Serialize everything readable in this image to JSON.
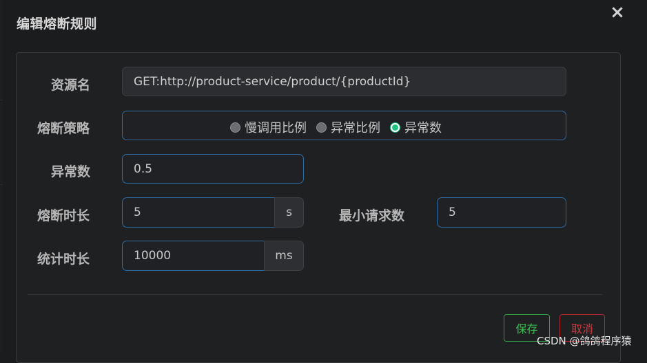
{
  "dialog": {
    "title": "编辑熔断规则",
    "close_symbol": "×"
  },
  "form": {
    "resource_label": "资源名",
    "resource_value": "GET:http://product-service/product/{productId}",
    "strategy_label": "熔断策略",
    "strategy_options": [
      {
        "label": "慢调用比例",
        "checked": false
      },
      {
        "label": "异常比例",
        "checked": false
      },
      {
        "label": "异常数",
        "checked": true
      }
    ],
    "exception_count_label": "异常数",
    "exception_count_value": "0.5",
    "break_duration_label": "熔断时长",
    "break_duration_value": "5",
    "break_duration_unit": "s",
    "min_requests_label": "最小请求数",
    "min_requests_value": "5",
    "stat_duration_label": "统计时长",
    "stat_duration_value": "10000",
    "stat_duration_unit": "ms"
  },
  "actions": {
    "save_label": "保存",
    "cancel_label": "取消"
  },
  "watermark": "CSDN @鸽鸽程序猿",
  "colors": {
    "accent_border": "#2e6da4",
    "save": "#3dbb52",
    "cancel": "#d8353f",
    "radio_checked": "#19c37d"
  }
}
